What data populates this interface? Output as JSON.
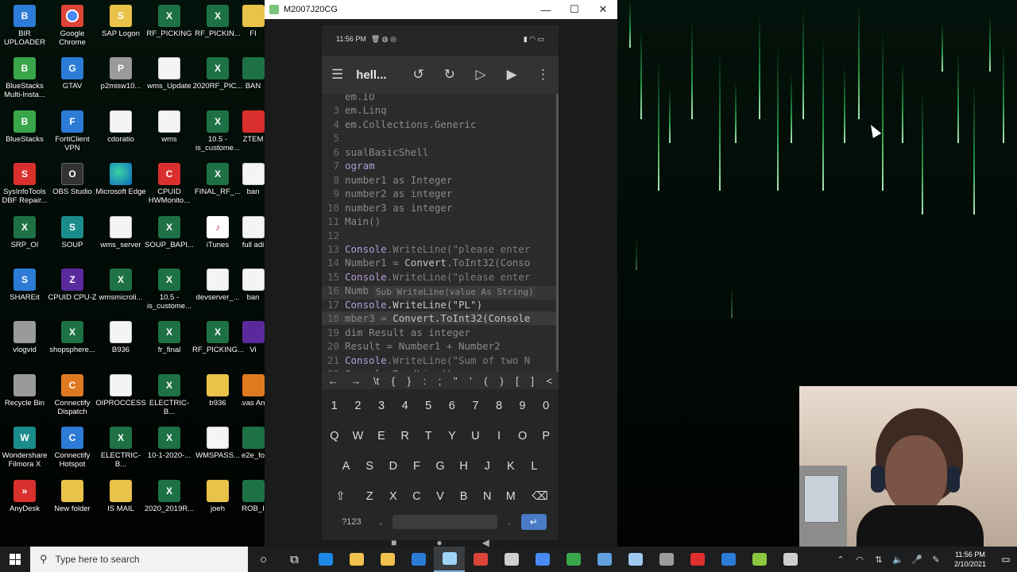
{
  "desktop": {
    "icons": [
      {
        "label": "BIR UPLOADER",
        "glyph": "B",
        "kind": "g-blue"
      },
      {
        "label": "Google Chrome",
        "glyph": "",
        "kind": "g-chrome"
      },
      {
        "label": "SAP Logon",
        "glyph": "S",
        "kind": "g-folder"
      },
      {
        "label": "RF_PICKING",
        "glyph": "X",
        "kind": "g-excel"
      },
      {
        "label": "RF_PICKIN...",
        "glyph": "X",
        "kind": "g-excel"
      },
      {
        "label": "BlueStacks Multi-Insta...",
        "glyph": "B",
        "kind": "g-green"
      },
      {
        "label": "GTAV",
        "glyph": "G",
        "kind": "g-blue"
      },
      {
        "label": "p2misw10...",
        "glyph": "P",
        "kind": "g-gray"
      },
      {
        "label": "wms_Update",
        "glyph": "",
        "kind": "g-doc"
      },
      {
        "label": "2020RF_PIC...",
        "glyph": "X",
        "kind": "g-excel"
      },
      {
        "label": "BlueStacks",
        "glyph": "B",
        "kind": "g-green"
      },
      {
        "label": "FortiClient VPN",
        "glyph": "F",
        "kind": "g-blue"
      },
      {
        "label": "cdoratio",
        "glyph": "",
        "kind": "g-doc"
      },
      {
        "label": "wms",
        "glyph": "",
        "kind": "g-doc"
      },
      {
        "label": "10.5 - is_custome...",
        "glyph": "X",
        "kind": "g-excel"
      },
      {
        "label": "SysInfoTools DBF Repair...",
        "glyph": "S",
        "kind": "g-red"
      },
      {
        "label": "OBS Studio",
        "glyph": "O",
        "kind": "g-dark"
      },
      {
        "label": "Microsoft Edge",
        "glyph": "",
        "kind": "g-edge"
      },
      {
        "label": "CPUID HWMonito...",
        "glyph": "C",
        "kind": "g-red"
      },
      {
        "label": "FINAL_RF_...",
        "glyph": "X",
        "kind": "g-excel"
      },
      {
        "label": "SRP_OI",
        "glyph": "X",
        "kind": "g-excel"
      },
      {
        "label": "SOUP",
        "glyph": "S",
        "kind": "g-teal"
      },
      {
        "label": "wms_server",
        "glyph": "",
        "kind": "g-doc"
      },
      {
        "label": "SOUP_BAPI...",
        "glyph": "X",
        "kind": "g-excel"
      },
      {
        "label": "iTunes",
        "glyph": "♪",
        "kind": "g-itunes"
      },
      {
        "label": "SHAREit",
        "glyph": "S",
        "kind": "g-blue"
      },
      {
        "label": "CPUID CPU-Z",
        "glyph": "Z",
        "kind": "g-purple"
      },
      {
        "label": "wmsmicroli...",
        "glyph": "X",
        "kind": "g-excel"
      },
      {
        "label": "10.5 - is_custome...",
        "glyph": "X",
        "kind": "g-excel"
      },
      {
        "label": "devserver_...",
        "glyph": "",
        "kind": "g-doc"
      },
      {
        "label": "vlogvid",
        "glyph": "",
        "kind": "g-gray"
      },
      {
        "label": "shopsphere...",
        "glyph": "X",
        "kind": "g-excel"
      },
      {
        "label": "B936",
        "glyph": "",
        "kind": "g-doc"
      },
      {
        "label": "fr_final",
        "glyph": "X",
        "kind": "g-excel"
      },
      {
        "label": "RF_PICKING...",
        "glyph": "X",
        "kind": "g-excel"
      },
      {
        "label": "Recycle Bin",
        "glyph": "",
        "kind": "g-gray"
      },
      {
        "label": "Connectify Dispatch",
        "glyph": "C",
        "kind": "g-orange"
      },
      {
        "label": "OIPROCCESS",
        "glyph": "",
        "kind": "g-doc"
      },
      {
        "label": "ELECTRIC-B...",
        "glyph": "X",
        "kind": "g-excel"
      },
      {
        "label": "b936",
        "glyph": "",
        "kind": "g-folder"
      },
      {
        "label": "Wondershare Filmora X",
        "glyph": "W",
        "kind": "g-teal"
      },
      {
        "label": "Connectify Hotspot",
        "glyph": "C",
        "kind": "g-blue"
      },
      {
        "label": "ELECTRIC-B...",
        "glyph": "X",
        "kind": "g-excel"
      },
      {
        "label": "10-1-2020-...",
        "glyph": "X",
        "kind": "g-excel"
      },
      {
        "label": "WMSPASS...",
        "glyph": "",
        "kind": "g-doc"
      },
      {
        "label": "AnyDesk",
        "glyph": "»",
        "kind": "g-red"
      },
      {
        "label": "New folder",
        "glyph": "",
        "kind": "g-folder"
      },
      {
        "label": "IS MAIL",
        "glyph": "",
        "kind": "g-folder"
      },
      {
        "label": "2020_2019R...",
        "glyph": "X",
        "kind": "g-excel"
      },
      {
        "label": "joeh",
        "glyph": "",
        "kind": "g-folder"
      }
    ],
    "partial_icons": [
      {
        "label": "FI",
        "kind": "g-folder"
      },
      {
        "label": "BAN",
        "kind": "g-excel"
      },
      {
        "label": "ZTEM",
        "kind": "g-red"
      },
      {
        "label": "ban",
        "kind": "g-doc"
      },
      {
        "label": "full adi",
        "kind": "g-doc"
      },
      {
        "label": "ban",
        "kind": "g-doc"
      },
      {
        "label": "Vi",
        "kind": "g-purple"
      },
      {
        "label": "Avas Anti",
        "kind": "g-orange"
      },
      {
        "label": "e2e_fo",
        "kind": "g-excel"
      },
      {
        "label": "ROB_I",
        "kind": "g-excel"
      }
    ]
  },
  "window": {
    "title": "M2007J20CG",
    "minimize": "—",
    "maximize": "☐",
    "close": "✕"
  },
  "phone": {
    "status_time": "11:56 PM",
    "status_icons_left": "🗑 ◍ ◎",
    "status_icons_right": "▮ ◠ ▭",
    "app_title": "hell...",
    "code_lines": [
      {
        "n": "",
        "parts": [
          {
            "t": "em.IO",
            "c": "tx"
          }
        ]
      },
      {
        "n": "3",
        "parts": [
          {
            "t": "em.Linq",
            "c": "tx"
          }
        ]
      },
      {
        "n": "4",
        "parts": [
          {
            "t": "em.Collections.Generic",
            "c": "tx"
          }
        ]
      },
      {
        "n": "5",
        "parts": [
          {
            "t": "",
            "c": "tx"
          }
        ]
      },
      {
        "n": "6",
        "parts": [
          {
            "t": "sualBasicShell",
            "c": "tx"
          }
        ]
      },
      {
        "n": "7",
        "parts": [
          {
            "t": "ogram",
            "c": "kw"
          }
        ]
      },
      {
        "n": "8",
        "parts": [
          {
            "t": "number1 as Integer",
            "c": "tx"
          }
        ]
      },
      {
        "n": "9",
        "parts": [
          {
            "t": "number2 as integer",
            "c": "tx"
          }
        ]
      },
      {
        "n": "10",
        "parts": [
          {
            "t": "number3 as integer",
            "c": "tx"
          }
        ]
      },
      {
        "n": "11",
        "parts": [
          {
            "t": "Main()",
            "c": "tx"
          }
        ]
      },
      {
        "n": "12",
        "parts": [
          {
            "t": "",
            "c": "tx"
          }
        ]
      },
      {
        "n": "13",
        "parts": [
          {
            "t": "Console",
            "c": "kw"
          },
          {
            "t": ".WriteLine(\"please enter",
            "c": "str"
          }
        ]
      },
      {
        "n": "14",
        "parts": [
          {
            "t": "Number1 = ",
            "c": "tx"
          },
          {
            "t": "Convert",
            "c": "bright"
          },
          {
            "t": ".ToInt32(Conso",
            "c": "tx"
          }
        ]
      },
      {
        "n": "15",
        "parts": [
          {
            "t": "Console",
            "c": "kw"
          },
          {
            "t": ".WriteLine(\"please enter",
            "c": "str"
          }
        ]
      },
      {
        "n": "16",
        "parts": [
          {
            "t": "Numb",
            "c": "tx"
          }
        ]
      },
      {
        "n": "17",
        "parts": [
          {
            "t": "Console",
            "c": "kw"
          },
          {
            "t": ".WriteLine(\"PL\")",
            "c": "bright"
          }
        ]
      },
      {
        "n": "18",
        "parts": [
          {
            "t": "mber3 = ",
            "c": "tx"
          },
          {
            "t": "Convert",
            "c": "bright"
          },
          {
            "t": ".ToInt32(Console",
            "c": "bright"
          }
        ]
      },
      {
        "n": "19",
        "parts": [
          {
            "t": "dim Result as integer",
            "c": "tx"
          }
        ]
      },
      {
        "n": "20",
        "parts": [
          {
            "t": "Result = Number1 + Number2",
            "c": "tx"
          }
        ]
      },
      {
        "n": "21",
        "parts": [
          {
            "t": "Console",
            "c": "kw"
          },
          {
            "t": ".WriteLine(\"Sum of two N",
            "c": "str"
          }
        ]
      },
      {
        "n": "22",
        "parts": [
          {
            "t": "Console.ReadLine()",
            "c": "tx"
          }
        ]
      }
    ],
    "autocomplete": "Sub WriteLine(value As String)",
    "symbols": [
      "←",
      "→",
      "\\t",
      "{",
      "}",
      ":",
      ";",
      "\"",
      "'",
      "(",
      ")",
      "[",
      "]",
      "<"
    ],
    "keys_numbers": [
      "1",
      "2",
      "3",
      "4",
      "5",
      "6",
      "7",
      "8",
      "9",
      "0"
    ],
    "keys_row1": [
      "Q",
      "W",
      "E",
      "R",
      "T",
      "Y",
      "U",
      "I",
      "O",
      "P"
    ],
    "keys_row2": [
      "A",
      "S",
      "D",
      "F",
      "G",
      "H",
      "J",
      "K",
      "L"
    ],
    "keys_row3": [
      "Z",
      "X",
      "C",
      "V",
      "B",
      "N",
      "M"
    ],
    "key_shift": "⇧",
    "key_backspace": "⌫",
    "key_symbols": "?123",
    "key_comma": ",",
    "key_period": ".",
    "key_enter": "↵",
    "nav_recents": "■",
    "nav_home": "●",
    "nav_back": "◀"
  },
  "taskbar": {
    "search_placeholder": "Type here to search",
    "search_icon": "search-icon",
    "apps": [
      {
        "name": "task-view-icon",
        "color": "#ffffff",
        "glyph": "○"
      },
      {
        "name": "multitask-icon",
        "color": "#ffffff",
        "glyph": "⧉"
      },
      {
        "name": "edge-icon",
        "color": "#1e88e5",
        "glyph": ""
      },
      {
        "name": "file-explorer-icon",
        "color": "#f2c14e",
        "glyph": ""
      },
      {
        "name": "store-icon",
        "color": "#f2c14e",
        "glyph": ""
      },
      {
        "name": "mail-icon",
        "color": "#2c7bd6",
        "glyph": ""
      },
      {
        "name": "scrcpy-icon",
        "color": "#9fd3f5",
        "glyph": ""
      },
      {
        "name": "chrome-icon",
        "color": "#db4437",
        "glyph": ""
      },
      {
        "name": "link-icon",
        "color": "#cfcfcf",
        "glyph": ""
      },
      {
        "name": "pen-icon",
        "color": "#4a8af4",
        "glyph": ""
      },
      {
        "name": "download-icon",
        "color": "#3aa64a",
        "glyph": ""
      },
      {
        "name": "remote-desktop-icon",
        "color": "#62a0e0",
        "glyph": ""
      },
      {
        "name": "paper-icon",
        "color": "#9fc9f0",
        "glyph": ""
      },
      {
        "name": "tool-icon",
        "color": "#9c9c9c",
        "glyph": ""
      },
      {
        "name": "anydesk-icon",
        "color": "#e0302e",
        "glyph": ""
      },
      {
        "name": "shield-icon",
        "color": "#2c7bd6",
        "glyph": ""
      },
      {
        "name": "bluestacks-icon",
        "color": "#8cc63f",
        "glyph": ""
      },
      {
        "name": "gauge-icon",
        "color": "#cfcfcf",
        "glyph": ""
      }
    ],
    "tray": {
      "chevron": "⌃",
      "wifi": "◠",
      "network": "⇅",
      "volume": "🔈",
      "mic": "🎤",
      "pen": "✎"
    },
    "time": "11:56 PM",
    "date": "2/10/2021",
    "notifications": "▭"
  }
}
